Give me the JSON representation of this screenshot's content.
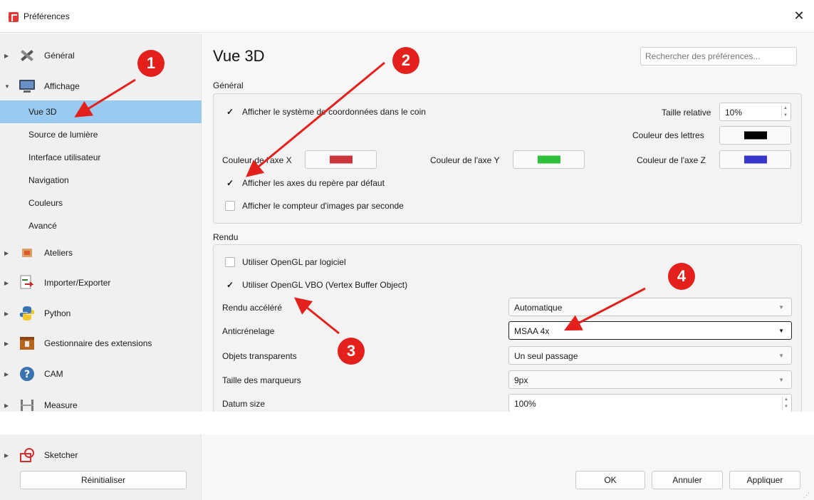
{
  "window": {
    "title": "Préférences",
    "close_glyph": "✕"
  },
  "sidebar": {
    "items": [
      {
        "label": "Général",
        "icon": "tools-icon",
        "caret": "▶"
      },
      {
        "label": "Affichage",
        "icon": "monitor-icon",
        "caret": "▼"
      },
      {
        "label": "Vue 3D",
        "selected": true
      },
      {
        "label": "Source de lumière"
      },
      {
        "label": "Interface utilisateur"
      },
      {
        "label": "Navigation"
      },
      {
        "label": "Couleurs"
      },
      {
        "label": "Avancé"
      },
      {
        "label": "Ateliers",
        "icon": "workbench-icon",
        "caret": "▶"
      },
      {
        "label": "Importer/Exporter",
        "icon": "import-export-icon",
        "caret": "▶"
      },
      {
        "label": "Python",
        "icon": "python-icon",
        "caret": "▶"
      },
      {
        "label": "Gestionnaire des extensions",
        "icon": "addon-box-icon",
        "caret": "▶"
      },
      {
        "label": "CAM",
        "icon": "cam-icon",
        "caret": "▶"
      },
      {
        "label": "Measure",
        "icon": "measure-icon",
        "caret": "▶"
      },
      {
        "label": "Sketcher",
        "icon": "sketcher-icon",
        "caret": "▶"
      }
    ],
    "reset_label": "Réinitialiser"
  },
  "page": {
    "title": "Vue 3D",
    "search_placeholder": "Rechercher des préférences..."
  },
  "general": {
    "section_label": "Général",
    "show_axis_corner": {
      "label": "Afficher le système de coordonnées dans le coin",
      "checked": true,
      "mark": "✓"
    },
    "relative_size": {
      "label": "Taille relative",
      "value": "10%"
    },
    "letter_color": {
      "label": "Couleur des lettres",
      "color": "#000000"
    },
    "axis_x": {
      "label": "Couleur de l'axe X",
      "color": "#c8363b"
    },
    "axis_y": {
      "label": "Couleur de l'axe Y",
      "color": "#2fbf3a"
    },
    "axis_z": {
      "label": "Couleur de l'axe Z",
      "color": "#3636c8"
    },
    "show_default_axes": {
      "label": "Afficher les axes du repère par défaut",
      "checked": true,
      "mark": "✓"
    },
    "show_fps": {
      "label": "Afficher le compteur d'images par seconde",
      "checked": false
    }
  },
  "render": {
    "section_label": "Rendu",
    "software_opengl": {
      "label": "Utiliser OpenGL par logiciel",
      "checked": false
    },
    "opengl_vbo": {
      "label": "Utiliser OpenGL VBO (Vertex Buffer Object)",
      "checked": true,
      "mark": "✓"
    },
    "accelerated": {
      "label": "Rendu accéléré",
      "value": "Automatique"
    },
    "antialiasing": {
      "label": "Anticrénelage",
      "value": "MSAA 4x"
    },
    "transparent": {
      "label": "Objets transparents",
      "value": "Un seul passage"
    },
    "marker_size": {
      "label": "Taille des marqueurs",
      "value": "9px"
    },
    "datum_size": {
      "label": "Datum size",
      "value": "100%"
    }
  },
  "buttons": {
    "ok": "OK",
    "cancel": "Annuler",
    "apply": "Appliquer"
  },
  "annotations": [
    "1",
    "2",
    "3",
    "4"
  ],
  "colors": {
    "selection": "#99c9ef",
    "marker": "#e3201b"
  }
}
